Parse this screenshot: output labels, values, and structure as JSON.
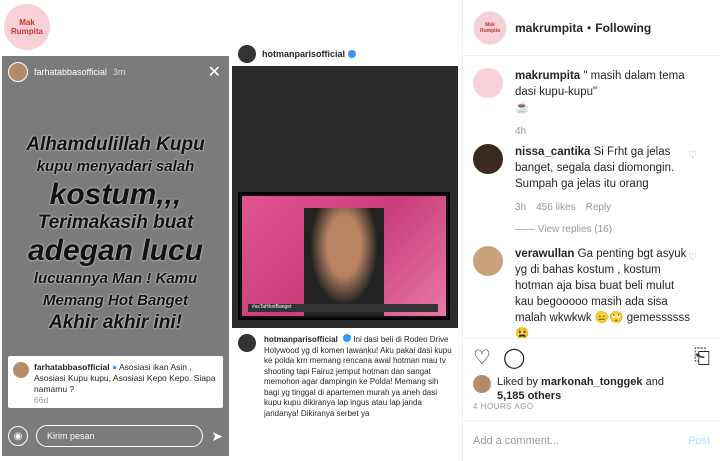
{
  "left_logo": {
    "text": "Mak Rumpita"
  },
  "story": {
    "username": "farhatabbasofficial",
    "time": "3m",
    "text_lines": [
      {
        "t": "Alhamdulillah Kupu",
        "s": "med"
      },
      {
        "t": "kupu menyadari salah",
        "s": "sm"
      },
      {
        "t": "kostum,,,",
        "s": "big"
      },
      {
        "t": "Terimakasih buat",
        "s": "med"
      },
      {
        "t": "adegan lucu",
        "s": "big"
      },
      {
        "t": "lucuannya Man ! Kamu",
        "s": "sm"
      },
      {
        "t": "Memang Hot Banget",
        "s": "sm"
      },
      {
        "t": "Akhir akhir ini!",
        "s": "med"
      }
    ],
    "comment_user": "farhatabbasofficial",
    "comment_text": "Asosiasi ikan Asin , Asosiasi Kupu kupu, Asosiasi Kepo Kepo. Siapa namamu ?",
    "comment_time": "66d",
    "message_placeholder": "Kirim pesan"
  },
  "post": {
    "username": "hotmanparisofficial",
    "tv_caption": "#ssTaHhotBanget",
    "caption_user": "hotmanparisofficial",
    "caption_text": "Ini dasi beli di Rodeo Drive Holywood yg di komen lawanku! Aku pakai dasi kupu ke polda krn memang rencana awal hotman mau tv shooting tapi Fairuz jemput hotman dan sangat memohon agar dampingin ke Polda! Memang sih bagi yg tinggal di apartemen murah ya aneh dasi kupu kupu dikiranya lap ingus atau lap janda jandanya! Dikiranya serbet ya"
  },
  "right": {
    "header_user": "makrumpita",
    "header_sep": "•",
    "header_follow": "Following",
    "comments": [
      {
        "user": "makrumpita",
        "text": "\" masih dalam tema dasi kupu-kupu\"",
        "emoji": "☕",
        "time": "4h",
        "likes": "",
        "reply": ""
      },
      {
        "user": "nissa_cantika",
        "text": "Si Frht ga jelas banget, segala dasi diomongin. Sumpah ga jelas itu orang",
        "emoji": "",
        "time": "3h",
        "likes": "456 likes",
        "reply": "Reply",
        "view_replies": "View replies (16)"
      },
      {
        "user": "verawullan",
        "text": "Ga penting bgt asyuk yg di bahas kostum , kostum hotman aja bisa buat beli mulut kau begooooo masih ada sisa malah wkwkwk 😑🙄 gemessssss",
        "emoji": "😫",
        "time": "",
        "likes": "",
        "reply": ""
      }
    ],
    "liked_by_prefix": "Liked by",
    "liked_by_user": "markonah_tonggek",
    "liked_and": "and",
    "liked_count": "5,185 others",
    "time_ago": "4 HOURS AGO",
    "add_comment_placeholder": "Add a comment...",
    "post_button": "Post"
  }
}
